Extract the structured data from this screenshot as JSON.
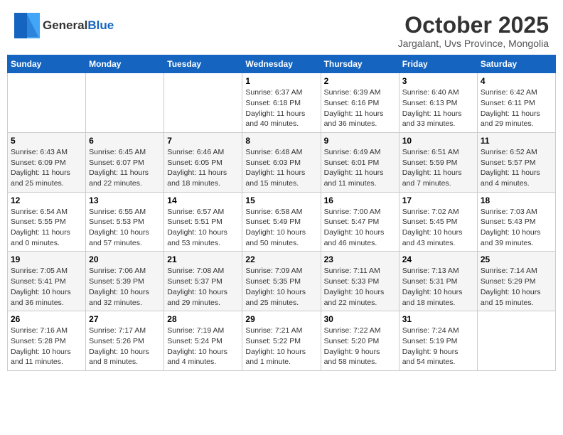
{
  "header": {
    "logo_general": "General",
    "logo_blue": "Blue",
    "month_title": "October 2025",
    "location": "Jargalant, Uvs Province, Mongolia"
  },
  "calendar": {
    "days_of_week": [
      "Sunday",
      "Monday",
      "Tuesday",
      "Wednesday",
      "Thursday",
      "Friday",
      "Saturday"
    ],
    "weeks": [
      [
        {
          "day": "",
          "info": ""
        },
        {
          "day": "",
          "info": ""
        },
        {
          "day": "",
          "info": ""
        },
        {
          "day": "1",
          "info": "Sunrise: 6:37 AM\nSunset: 6:18 PM\nDaylight: 11 hours\nand 40 minutes."
        },
        {
          "day": "2",
          "info": "Sunrise: 6:39 AM\nSunset: 6:16 PM\nDaylight: 11 hours\nand 36 minutes."
        },
        {
          "day": "3",
          "info": "Sunrise: 6:40 AM\nSunset: 6:13 PM\nDaylight: 11 hours\nand 33 minutes."
        },
        {
          "day": "4",
          "info": "Sunrise: 6:42 AM\nSunset: 6:11 PM\nDaylight: 11 hours\nand 29 minutes."
        }
      ],
      [
        {
          "day": "5",
          "info": "Sunrise: 6:43 AM\nSunset: 6:09 PM\nDaylight: 11 hours\nand 25 minutes."
        },
        {
          "day": "6",
          "info": "Sunrise: 6:45 AM\nSunset: 6:07 PM\nDaylight: 11 hours\nand 22 minutes."
        },
        {
          "day": "7",
          "info": "Sunrise: 6:46 AM\nSunset: 6:05 PM\nDaylight: 11 hours\nand 18 minutes."
        },
        {
          "day": "8",
          "info": "Sunrise: 6:48 AM\nSunset: 6:03 PM\nDaylight: 11 hours\nand 15 minutes."
        },
        {
          "day": "9",
          "info": "Sunrise: 6:49 AM\nSunset: 6:01 PM\nDaylight: 11 hours\nand 11 minutes."
        },
        {
          "day": "10",
          "info": "Sunrise: 6:51 AM\nSunset: 5:59 PM\nDaylight: 11 hours\nand 7 minutes."
        },
        {
          "day": "11",
          "info": "Sunrise: 6:52 AM\nSunset: 5:57 PM\nDaylight: 11 hours\nand 4 minutes."
        }
      ],
      [
        {
          "day": "12",
          "info": "Sunrise: 6:54 AM\nSunset: 5:55 PM\nDaylight: 11 hours\nand 0 minutes."
        },
        {
          "day": "13",
          "info": "Sunrise: 6:55 AM\nSunset: 5:53 PM\nDaylight: 10 hours\nand 57 minutes."
        },
        {
          "day": "14",
          "info": "Sunrise: 6:57 AM\nSunset: 5:51 PM\nDaylight: 10 hours\nand 53 minutes."
        },
        {
          "day": "15",
          "info": "Sunrise: 6:58 AM\nSunset: 5:49 PM\nDaylight: 10 hours\nand 50 minutes."
        },
        {
          "day": "16",
          "info": "Sunrise: 7:00 AM\nSunset: 5:47 PM\nDaylight: 10 hours\nand 46 minutes."
        },
        {
          "day": "17",
          "info": "Sunrise: 7:02 AM\nSunset: 5:45 PM\nDaylight: 10 hours\nand 43 minutes."
        },
        {
          "day": "18",
          "info": "Sunrise: 7:03 AM\nSunset: 5:43 PM\nDaylight: 10 hours\nand 39 minutes."
        }
      ],
      [
        {
          "day": "19",
          "info": "Sunrise: 7:05 AM\nSunset: 5:41 PM\nDaylight: 10 hours\nand 36 minutes."
        },
        {
          "day": "20",
          "info": "Sunrise: 7:06 AM\nSunset: 5:39 PM\nDaylight: 10 hours\nand 32 minutes."
        },
        {
          "day": "21",
          "info": "Sunrise: 7:08 AM\nSunset: 5:37 PM\nDaylight: 10 hours\nand 29 minutes."
        },
        {
          "day": "22",
          "info": "Sunrise: 7:09 AM\nSunset: 5:35 PM\nDaylight: 10 hours\nand 25 minutes."
        },
        {
          "day": "23",
          "info": "Sunrise: 7:11 AM\nSunset: 5:33 PM\nDaylight: 10 hours\nand 22 minutes."
        },
        {
          "day": "24",
          "info": "Sunrise: 7:13 AM\nSunset: 5:31 PM\nDaylight: 10 hours\nand 18 minutes."
        },
        {
          "day": "25",
          "info": "Sunrise: 7:14 AM\nSunset: 5:29 PM\nDaylight: 10 hours\nand 15 minutes."
        }
      ],
      [
        {
          "day": "26",
          "info": "Sunrise: 7:16 AM\nSunset: 5:28 PM\nDaylight: 10 hours\nand 11 minutes."
        },
        {
          "day": "27",
          "info": "Sunrise: 7:17 AM\nSunset: 5:26 PM\nDaylight: 10 hours\nand 8 minutes."
        },
        {
          "day": "28",
          "info": "Sunrise: 7:19 AM\nSunset: 5:24 PM\nDaylight: 10 hours\nand 4 minutes."
        },
        {
          "day": "29",
          "info": "Sunrise: 7:21 AM\nSunset: 5:22 PM\nDaylight: 10 hours\nand 1 minute."
        },
        {
          "day": "30",
          "info": "Sunrise: 7:22 AM\nSunset: 5:20 PM\nDaylight: 9 hours\nand 58 minutes."
        },
        {
          "day": "31",
          "info": "Sunrise: 7:24 AM\nSunset: 5:19 PM\nDaylight: 9 hours\nand 54 minutes."
        },
        {
          "day": "",
          "info": ""
        }
      ]
    ]
  }
}
